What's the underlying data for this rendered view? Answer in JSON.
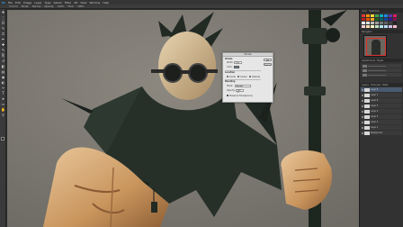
{
  "app": {
    "brand": "Ps",
    "menu": [
      "File",
      "Edit",
      "Image",
      "Layer",
      "Type",
      "Select",
      "Filter",
      "3D",
      "View",
      "Window",
      "Help"
    ]
  },
  "options_bar": {
    "items": [
      "Mode:",
      "Normal",
      "Opacity:",
      "100%",
      "Flow:",
      "100%"
    ]
  },
  "tools": {
    "icons": [
      "move-icon",
      "marquee-icon",
      "lasso-icon",
      "quick-select-icon",
      "crop-icon",
      "eyedropper-icon",
      "healing-icon",
      "brush-icon",
      "stamp-icon",
      "history-brush-icon",
      "eraser-icon",
      "gradient-icon",
      "blur-icon",
      "dodge-icon",
      "pen-icon",
      "type-icon",
      "path-select-icon",
      "shape-icon",
      "hand-icon",
      "zoom-icon"
    ],
    "glyphs": [
      "✥",
      "⬚",
      "ʘ",
      "✎",
      "⌗",
      "✒",
      "✚",
      "✎",
      "⎘",
      "↺",
      "◧",
      "▤",
      "◉",
      "◐",
      "✑",
      "T",
      "➤",
      "▭",
      "✋",
      "⚲"
    ],
    "foreground_color": "#1b1b1b",
    "background_color": "#e0e0e0"
  },
  "panels": {
    "swatch_tabs": [
      "Color",
      "Swatches"
    ],
    "swatches": [
      "#e53935",
      "#fb8c00",
      "#fdd835",
      "#43a047",
      "#00acc1",
      "#1e88e5",
      "#5e35b1",
      "#d81b60",
      "#b71c1c",
      "#e65100",
      "#f9a825",
      "#1b5e20",
      "#006064",
      "#0d47a1",
      "#311b92",
      "#880e4f",
      "#ffffff",
      "#e0e0e0",
      "#bdbdbd",
      "#9e9e9e",
      "#757575",
      "#616161",
      "#424242",
      "#212121",
      "#ffcdd2",
      "#ffe0b2",
      "#fff9c4",
      "#c8e6c9",
      "#b2ebf2",
      "#bbdefb",
      "#d1c4e9",
      "#f8bbd0"
    ],
    "nav_tab": "Navigator",
    "adjust_tabs": [
      "Adjustments",
      "Styles"
    ],
    "layer_tabs": [
      "Layers",
      "Channels",
      "Paths"
    ],
    "layers": [
      "Layer 8",
      "Layer 7",
      "Layer 6",
      "Layer 5",
      "Layer 4",
      "Layer 3",
      "Layer 2",
      "Layer 1",
      "Background"
    ]
  },
  "dialog": {
    "title": "Stroke",
    "ok": "OK",
    "cancel": "Cancel",
    "stroke_section": "Stroke",
    "width_label": "Width:",
    "width_value": "1 px",
    "color_label": "Color:",
    "color_value": "#6f8a9a",
    "location_section": "Location",
    "location_options": [
      "Inside",
      "Center",
      "Outside"
    ],
    "location_selected": "Center",
    "blending_section": "Blending",
    "mode_label": "Mode:",
    "mode_value": "Normal",
    "opacity_label": "Opacity:",
    "opacity_value": "100 %",
    "preserve_label": "Preserve Transparency"
  }
}
